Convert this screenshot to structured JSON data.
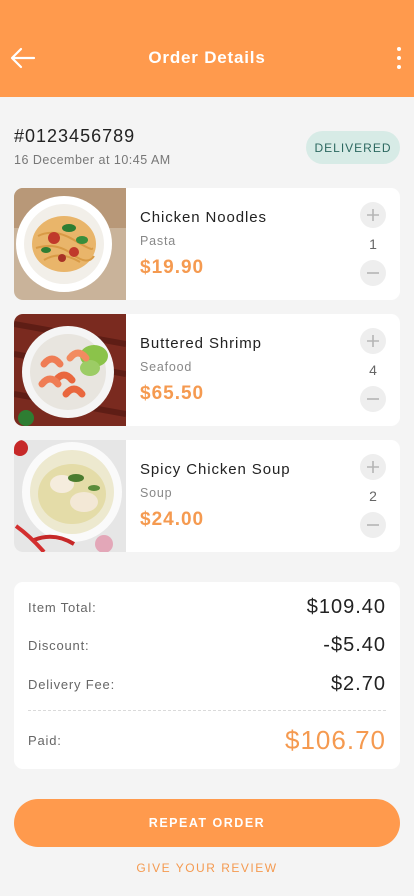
{
  "header": {
    "title": "Order Details",
    "back_icon": "arrow-left-icon",
    "more_icon": "vertical-dots-icon"
  },
  "order": {
    "id": "#0123456789",
    "date": "16 December at 10:45 AM",
    "status": "DELIVERED"
  },
  "items": [
    {
      "name": "Chicken Noodles",
      "category": "Pasta",
      "price": "$19.90",
      "quantity": "1"
    },
    {
      "name": "Buttered Shrimp",
      "category": "Seafood",
      "price": "$65.50",
      "quantity": "4"
    },
    {
      "name": "Spicy Chicken Soup",
      "category": "Soup",
      "price": "$24.00",
      "quantity": "2"
    }
  ],
  "summary": {
    "item_total_label": "Item Total:",
    "item_total_value": "$109.40",
    "discount_label": "Discount:",
    "discount_value": "-$5.40",
    "delivery_fee_label": "Delivery Fee:",
    "delivery_fee_value": "$2.70",
    "paid_label": "Paid:",
    "paid_value": "$106.70"
  },
  "actions": {
    "repeat_order": "REPEAT ORDER",
    "give_review": "GIVE YOUR REVIEW"
  },
  "colors": {
    "accent": "#ff9a4d",
    "price": "#f59a50",
    "badge_bg": "#d7ebe6",
    "badge_text": "#2c6860",
    "background": "#f4f4f4"
  }
}
